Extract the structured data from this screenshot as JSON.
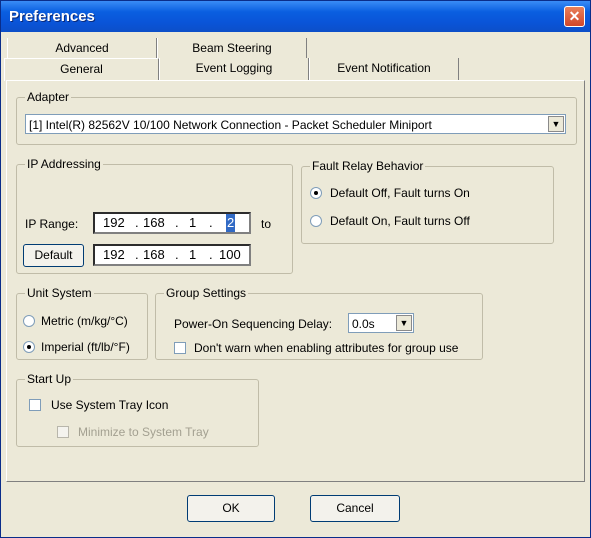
{
  "window": {
    "title": "Preferences",
    "close_glyph": "✕"
  },
  "tabs": {
    "row_back": [
      {
        "label": "Advanced"
      },
      {
        "label": "Beam Steering"
      }
    ],
    "row_front": [
      {
        "label": "General",
        "active": true
      },
      {
        "label": "Event Logging"
      },
      {
        "label": "Event Notification"
      }
    ]
  },
  "adapter": {
    "legend": "Adapter",
    "selected": "[1] Intel(R) 82562V 10/100 Network Connection - Packet Scheduler Miniport"
  },
  "ip_addressing": {
    "legend": "IP Addressing",
    "ip_range_label": "IP Range:",
    "start": {
      "o1": "192",
      "o2": "168",
      "o3": "1",
      "o4": "2"
    },
    "to_label": "to",
    "default_button": "Default",
    "end": {
      "o1": "192",
      "o2": "168",
      "o3": "1",
      "o4": "100"
    }
  },
  "fault_relay": {
    "legend": "Fault Relay Behavior",
    "options": [
      {
        "label": "Default Off, Fault turns On",
        "checked": true
      },
      {
        "label": "Default On, Fault turns Off",
        "checked": false
      }
    ]
  },
  "unit_system": {
    "legend": "Unit System",
    "options": [
      {
        "label": "Metric (m/kg/°C)",
        "checked": false
      },
      {
        "label": "Imperial (ft/lb/°F)",
        "checked": true
      }
    ]
  },
  "group_settings": {
    "legend": "Group Settings",
    "delay_label": "Power-On Sequencing Delay:",
    "delay_value": "0.0s",
    "dont_warn_label": "Don't warn when enabling attributes for group use",
    "dont_warn_checked": false
  },
  "startup": {
    "legend": "Start Up",
    "use_tray_label": "Use System Tray Icon",
    "use_tray_checked": false,
    "minimize_label": "Minimize to System Tray",
    "minimize_checked": false
  },
  "footer": {
    "ok": "OK",
    "cancel": "Cancel"
  },
  "colors": {
    "titlebar": "#0a54d8",
    "selection": "#316ac5",
    "face": "#ece9d8"
  }
}
